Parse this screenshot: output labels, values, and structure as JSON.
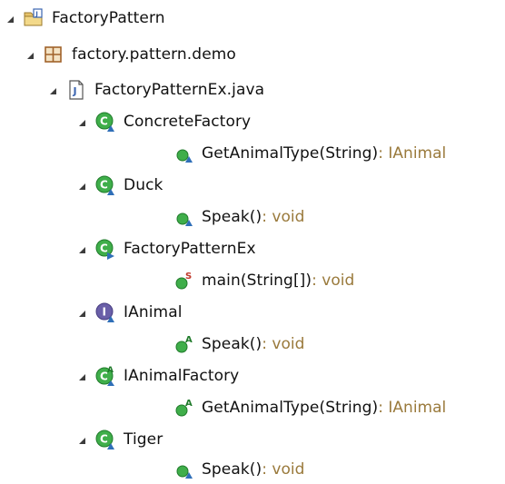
{
  "tree": {
    "project": {
      "label": "FactoryPattern",
      "icon": "java-project-folder-icon"
    },
    "package": {
      "label": "factory.pattern.demo",
      "icon": "package-icon"
    },
    "file": {
      "label": "FactoryPatternEx.java",
      "icon": "java-file-icon"
    },
    "types": [
      {
        "label": "ConcreteFactory",
        "icon": "class-icon",
        "member": {
          "label": "GetAnimalType(String)",
          "ret": " : IAnimal",
          "icon": "method-icon"
        }
      },
      {
        "label": "Duck",
        "icon": "class-icon",
        "member": {
          "label": "Speak()",
          "ret": " : void",
          "icon": "method-icon"
        }
      },
      {
        "label": "FactoryPatternEx",
        "icon": "class-main-icon",
        "member": {
          "label": "main(String[])",
          "ret": " : void",
          "icon": "static-method-icon"
        }
      },
      {
        "label": "IAnimal",
        "icon": "interface-icon",
        "member": {
          "label": "Speak()",
          "ret": " : void",
          "icon": "abstract-method-icon"
        }
      },
      {
        "label": "IAnimalFactory",
        "icon": "abstract-class-icon",
        "member": {
          "label": "GetAnimalType(String)",
          "ret": " : IAnimal",
          "icon": "abstract-method-icon"
        }
      },
      {
        "label": "Tiger",
        "icon": "class-icon",
        "member": {
          "label": "Speak()",
          "ret": " : void",
          "icon": "method-icon"
        }
      }
    ]
  },
  "colors": {
    "class_green": "#2e9b3a",
    "interface_purple": "#6a5fa8",
    "return_type": "#9a7a3c",
    "package_brown": "#a0622a",
    "java_file_blue": "#3a64b0"
  }
}
